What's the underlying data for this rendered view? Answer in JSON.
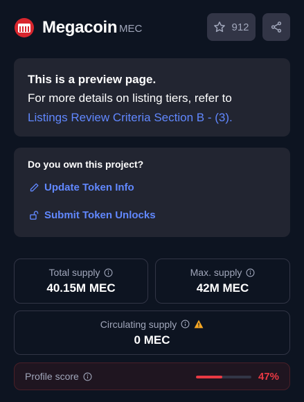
{
  "header": {
    "coin_name": "Megacoin",
    "coin_symbol": "MEC",
    "watchlist_count": "912",
    "icons": [
      "coin-logo-icon",
      "star-icon",
      "share-icon"
    ]
  },
  "preview": {
    "title": "This is a preview page.",
    "body": "For more details on listing tiers, refer to",
    "link_text": "Listings Review Criteria Section B - (3)."
  },
  "ownership": {
    "title": "Do you own this project?",
    "update_label": "Update Token Info",
    "unlocks_label": "Submit Token Unlocks",
    "icons": [
      "pencil-icon",
      "unlock-icon"
    ]
  },
  "stats": {
    "total_supply_label": "Total supply",
    "total_supply_value": "40.15M MEC",
    "max_supply_label": "Max. supply",
    "max_supply_value": "42M MEC",
    "circulating_supply_label": "Circulating supply",
    "circulating_supply_value": "0 MEC"
  },
  "profile_score": {
    "label": "Profile score",
    "value": "47%",
    "fraction": 0.47
  },
  "colors": {
    "background": "#0d1421",
    "card": "#222531",
    "link": "#6188ff",
    "danger": "#ea3943",
    "warning": "#f5a623",
    "muted": "#a1a7bb"
  }
}
